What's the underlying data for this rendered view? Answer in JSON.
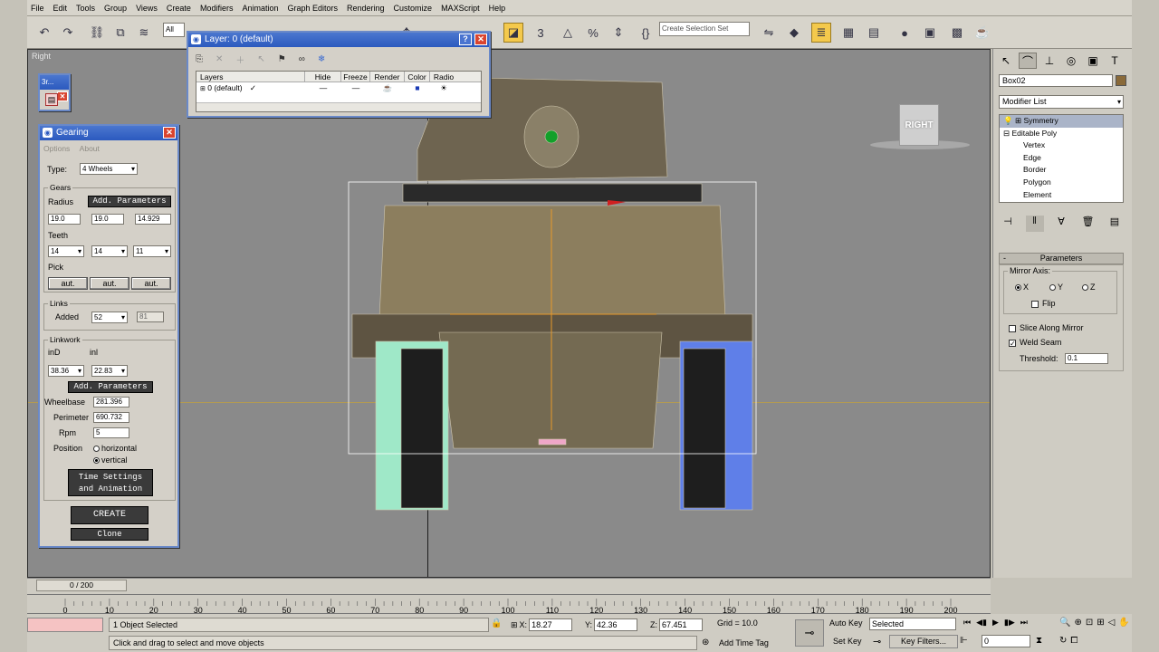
{
  "menu": [
    "File",
    "Edit",
    "Tools",
    "Group",
    "Views",
    "Create",
    "Modifiers",
    "Animation",
    "Graph Editors",
    "Rendering",
    "Customize",
    "MAXScript",
    "Help"
  ],
  "toolbar": {
    "filter_value": "All",
    "selection_set_placeholder": "Create Selection Set"
  },
  "viewport": {
    "label": "Right",
    "viewcube_label": "RIGHT"
  },
  "layer_dialog": {
    "title": "Layer: 0 (default)",
    "columns": [
      "Layers",
      "Hide",
      "Freeze",
      "Render",
      "Color",
      "Radio"
    ],
    "row_name": "0 (default)"
  },
  "small_window": {
    "title": "3r..."
  },
  "gearing": {
    "title": "Gearing",
    "menu": [
      "Options",
      "About"
    ],
    "type_label": "Type:",
    "type_value": "4 Wheels",
    "gears_group": "Gears",
    "radius_label": "Radius",
    "add_params_label": "Add. Parameters",
    "radius_values": [
      "19.0",
      "19.0",
      "14.929"
    ],
    "teeth_label": "Teeth",
    "teeth_values": [
      "14",
      "14",
      "11"
    ],
    "pick_label": "Pick",
    "pick_buttons": [
      "aut.",
      "aut.",
      "aut."
    ],
    "links_group": "Links",
    "added_label": "Added",
    "added_value": "52",
    "added_readout": "81",
    "linkwork_group": "Linkwork",
    "ind_label": "inD",
    "inl_label": "inl",
    "ind_value": "38.36",
    "inl_value": "22.83",
    "add_params2_label": "Add. Parameters",
    "wheelbase_label": "Wheelbase",
    "wheelbase_value": "281.396",
    "perimeter_label": "Perimeter",
    "perimeter_value": "690.732",
    "rpm_label": "Rpm",
    "rpm_value": "5",
    "position_label": "Position",
    "pos_horizontal": "horizontal",
    "pos_vertical": "vertical",
    "time_settings_line1": "Time Settings",
    "time_settings_line2": "and Animation",
    "create_label": "CREATE",
    "clone_label": "Clone"
  },
  "command_panel": {
    "object_name": "Box02",
    "modifier_list": "Modifier List",
    "stack": [
      "Symmetry",
      "Editable Poly",
      "Vertex",
      "Edge",
      "Border",
      "Polygon",
      "Element"
    ],
    "params_title": "Parameters",
    "mirror_axis_label": "Mirror Axis:",
    "axes": [
      "X",
      "Y",
      "Z"
    ],
    "flip_label": "Flip",
    "slice_label": "Slice Along Mirror",
    "weld_label": "Weld Seam",
    "threshold_label": "Threshold:",
    "threshold_value": "0.1"
  },
  "timeline": {
    "slider": "0 / 200",
    "ticks": [
      "0",
      "10",
      "20",
      "30",
      "40",
      "50",
      "60",
      "70",
      "80",
      "90",
      "100",
      "110",
      "120",
      "130",
      "140",
      "150",
      "160",
      "170",
      "180",
      "190",
      "200"
    ]
  },
  "status": {
    "selected": "1 Object Selected",
    "prompt": "Click and drag to select and move objects",
    "x": "18.27",
    "y": "42.36",
    "z": "67.451",
    "grid": "Grid = 10.0",
    "add_time_tag": "Add Time Tag",
    "auto_key": "Auto Key",
    "selected_dropdown": "Selected",
    "set_key": "Set Key",
    "key_filters": "Key Filters...",
    "frame": "0"
  },
  "colors": {
    "accent_yellow": "#f4c94c",
    "title_blue": "#2b59bf",
    "model_tan": "#8a7a5c"
  }
}
